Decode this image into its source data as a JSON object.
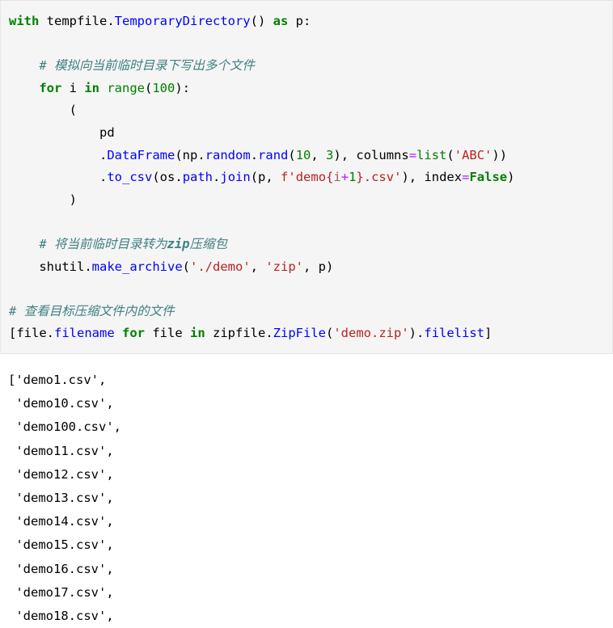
{
  "notebook": {
    "cell_type": "code",
    "language": "python",
    "colors": {
      "cell_background": "#f5f5f5",
      "cell_border": "#e3e3e3",
      "output_background": "#ffffff",
      "keyword": "#008000",
      "builtin": "#008000",
      "function": "#0000ff",
      "string": "#ba2121",
      "number": "#008000",
      "comment": "#408080",
      "operator": "#aa22ff",
      "text": "#000000"
    }
  },
  "code": {
    "line_01": {
      "kw_with": "with",
      "mod_tempfile": " tempfile",
      "dot1": ".",
      "fn_tempdir": "TemporaryDirectory",
      "parens": "()",
      "kw_as": " as ",
      "var_p": "p",
      "colon": ":"
    },
    "line_03_comment": "    # 模拟向当前临时目录下写出多个文件",
    "line_04": {
      "indent": "    ",
      "kw_for": "for",
      "var_i": " i ",
      "kw_in": "in",
      "fn_range": " range",
      "paren_open": "(",
      "num_100": "100",
      "paren_close_colon": "):"
    },
    "line_05_open_paren": "        (",
    "line_06_pd": "            pd",
    "line_07": {
      "indent": "            ",
      "dot_dataframe": ".",
      "fn_dataframe": "DataFrame",
      "paren_open": "(",
      "mod_np": "np",
      "dot1": ".",
      "fn_random": "random",
      "dot2": ".",
      "fn_rand": "rand",
      "paren2": "(",
      "num_10": "10",
      "comma": ", ",
      "num_3": "3",
      "close1": "), ",
      "kwarg_columns": "columns",
      "eq": "=",
      "fn_list": "list",
      "paren3": "(",
      "str_abc": "'ABC'",
      "close2": "))"
    },
    "line_08": {
      "indent": "            ",
      "dot": ".",
      "fn_to_csv": "to_csv",
      "paren_open": "(",
      "mod_os": "os",
      "dot1": ".",
      "attr_path": "path",
      "dot2": ".",
      "fn_join": "join",
      "paren2": "(",
      "var_p": "p",
      "comma": ", ",
      "fstr_prefix": "f'demo",
      "brace_open": "{",
      "fvar_i": "i",
      "fop_plus": "+",
      "fnum_1": "1",
      "brace_close": "}",
      "fstr_suffix": ".csv'",
      "close1": "), ",
      "kwarg_index": "index",
      "eq": "=",
      "kw_false": "False",
      "close2": ")"
    },
    "line_09_close_paren": "        )",
    "line_11_comment_pre": "    # 将当前临时目录转为",
    "line_11_comment_zip": "zip",
    "line_11_comment_post": "压缩包",
    "line_12": {
      "indent": "    ",
      "mod_shutil": "shutil",
      "dot": ".",
      "fn_make_archive": "make_archive",
      "paren_open": "(",
      "str_demo": "'./demo'",
      "comma1": ", ",
      "str_zip": "'zip'",
      "comma2": ", ",
      "var_p": "p",
      "paren_close": ")"
    },
    "line_14_comment": "# 查看目标压缩文件内的文件",
    "line_15": {
      "bracket_open": "[",
      "var_file": "file",
      "dot1": ".",
      "attr_filename": "filename",
      "kw_for": " for",
      "var_file2": " file ",
      "kw_in": "in",
      "mod_zipfile": " zipfile",
      "dot2": ".",
      "fn_zipfile_cls": "ZipFile",
      "paren_open": "(",
      "str_demozip": "'demo.zip'",
      "paren_close": ")",
      "dot3": ".",
      "attr_filelist": "filelist",
      "bracket_close": "]"
    }
  },
  "output": {
    "type": "execute_result",
    "lines": [
      "['demo1.csv',",
      " 'demo10.csv',",
      " 'demo100.csv',",
      " 'demo11.csv',",
      " 'demo12.csv',",
      " 'demo13.csv',",
      " 'demo14.csv',",
      " 'demo15.csv',",
      " 'demo16.csv',",
      " 'demo17.csv',",
      " 'demo18.csv',"
    ],
    "text": "['demo1.csv',\n 'demo10.csv',\n 'demo100.csv',\n 'demo11.csv',\n 'demo12.csv',\n 'demo13.csv',\n 'demo14.csv',\n 'demo15.csv',\n 'demo16.csv',\n 'demo17.csv',\n 'demo18.csv',"
  }
}
